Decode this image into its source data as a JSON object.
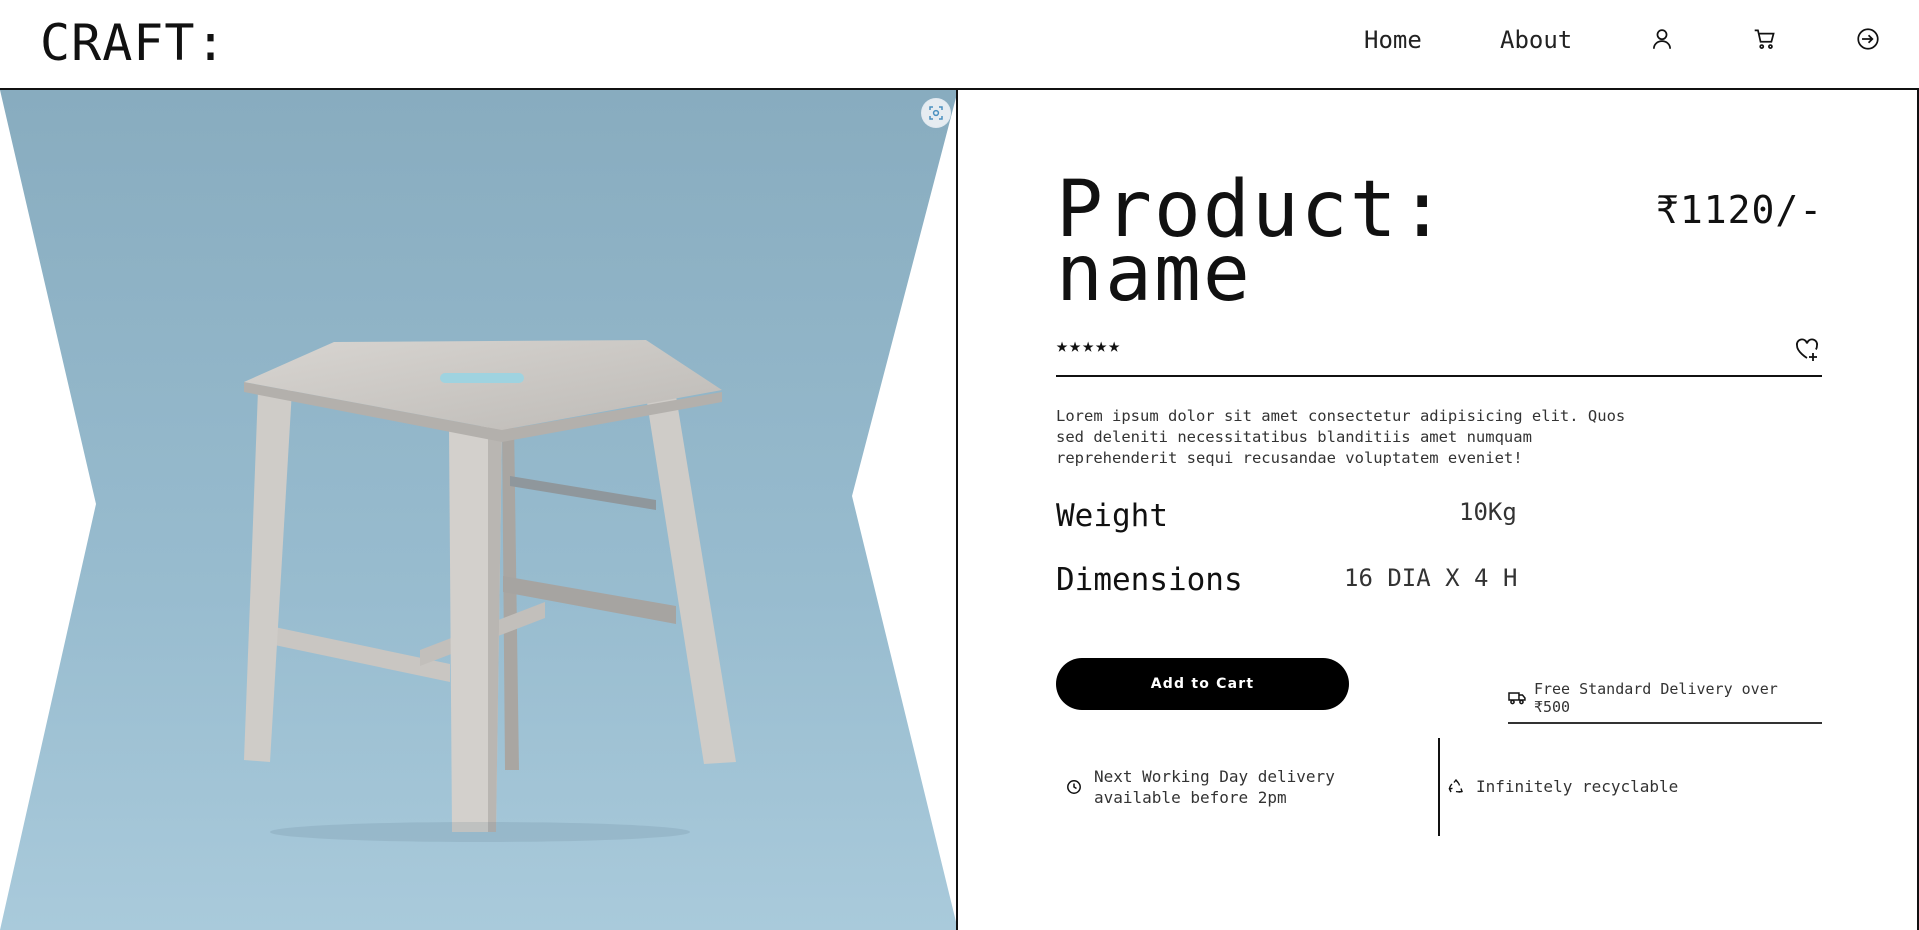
{
  "header": {
    "brand": "CRAFT:",
    "nav": {
      "home": "Home",
      "about": "About"
    },
    "icons": [
      "user-icon",
      "cart-icon",
      "login-icon"
    ]
  },
  "product": {
    "title": "Product:\nname",
    "price": "₹1120/-",
    "rating_stars": "★★★★★",
    "rating": 5,
    "rating_max": 5,
    "description": "Lorem ipsum dolor sit amet consectetur adipisicing elit. Quos sed deleniti necessitatibus blanditiis amet numquam reprehenderit sequi recusandae voluptatem eveniet!",
    "specs": {
      "weight_label": "Weight",
      "weight_value": "10Kg",
      "dimensions_label": "Dimensions",
      "dimensions_value": "16 DIA X 4 H"
    },
    "add_to_cart": "Add to Cart",
    "delivery_note": "Free Standard Delivery over ₹500",
    "features": {
      "next_day": "Next Working Day delivery available before 2pm",
      "recyclable": "Infinitely recyclable"
    }
  },
  "colors": {
    "backdrop": "#93b6c8",
    "button": "#000000",
    "text": "#111111"
  }
}
